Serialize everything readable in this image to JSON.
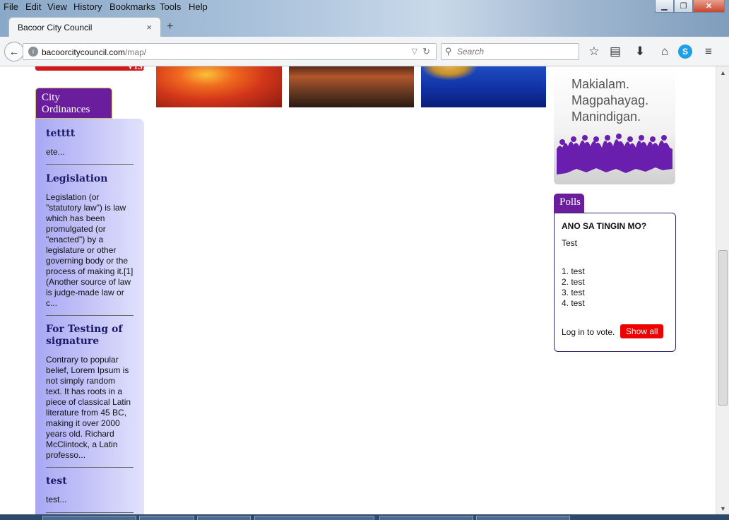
{
  "menubar": {
    "items": [
      "File",
      "Edit",
      "View",
      "History",
      "Bookmarks",
      "Tools",
      "Help"
    ]
  },
  "tab": {
    "title": "Bacoor City Council",
    "close_glyph": "×",
    "new_glyph": "+"
  },
  "nav": {
    "url_domain": "bacoorcitycouncil.com",
    "url_path": "/map/",
    "search_placeholder": "Search"
  },
  "banner": {
    "visit_label": "Visit Us"
  },
  "sidebar": {
    "tab_label": "City Ordinances",
    "items": [
      {
        "title": "tetttt",
        "text": "ete..."
      },
      {
        "title": "Legislation",
        "text": "Legislation (or \"statutory law\") is law which has been promulgated (or \"enacted\") by a legislature or other governing body or the process of making it.[1] (Another source of law is judge-made law or c..."
      },
      {
        "title": "For Testing of signature",
        "text": "Contrary to popular belief, Lorem Ipsum is not simply random text. It has roots in a piece of classical Latin literature from 45 BC, making it over 2000 years old. Richard McClintock, a Latin professo..."
      },
      {
        "title": "test",
        "text": "test..."
      }
    ]
  },
  "ad": {
    "line1": "Makialam.",
    "line2": "Magpahayag.",
    "line3": "Manindigan."
  },
  "polls": {
    "tab_label": "Polls",
    "question": "ANO SA TINGIN MO?",
    "description": "Test",
    "options": [
      "1. test",
      "2. test",
      "3. test",
      "4. test"
    ],
    "login_text": "Log in to vote.",
    "show_all_label": "Show all"
  },
  "colors": {
    "accent": "#6a1e9e",
    "button_red": "#e00000",
    "sidebar_blue": "#b4b4f6"
  }
}
